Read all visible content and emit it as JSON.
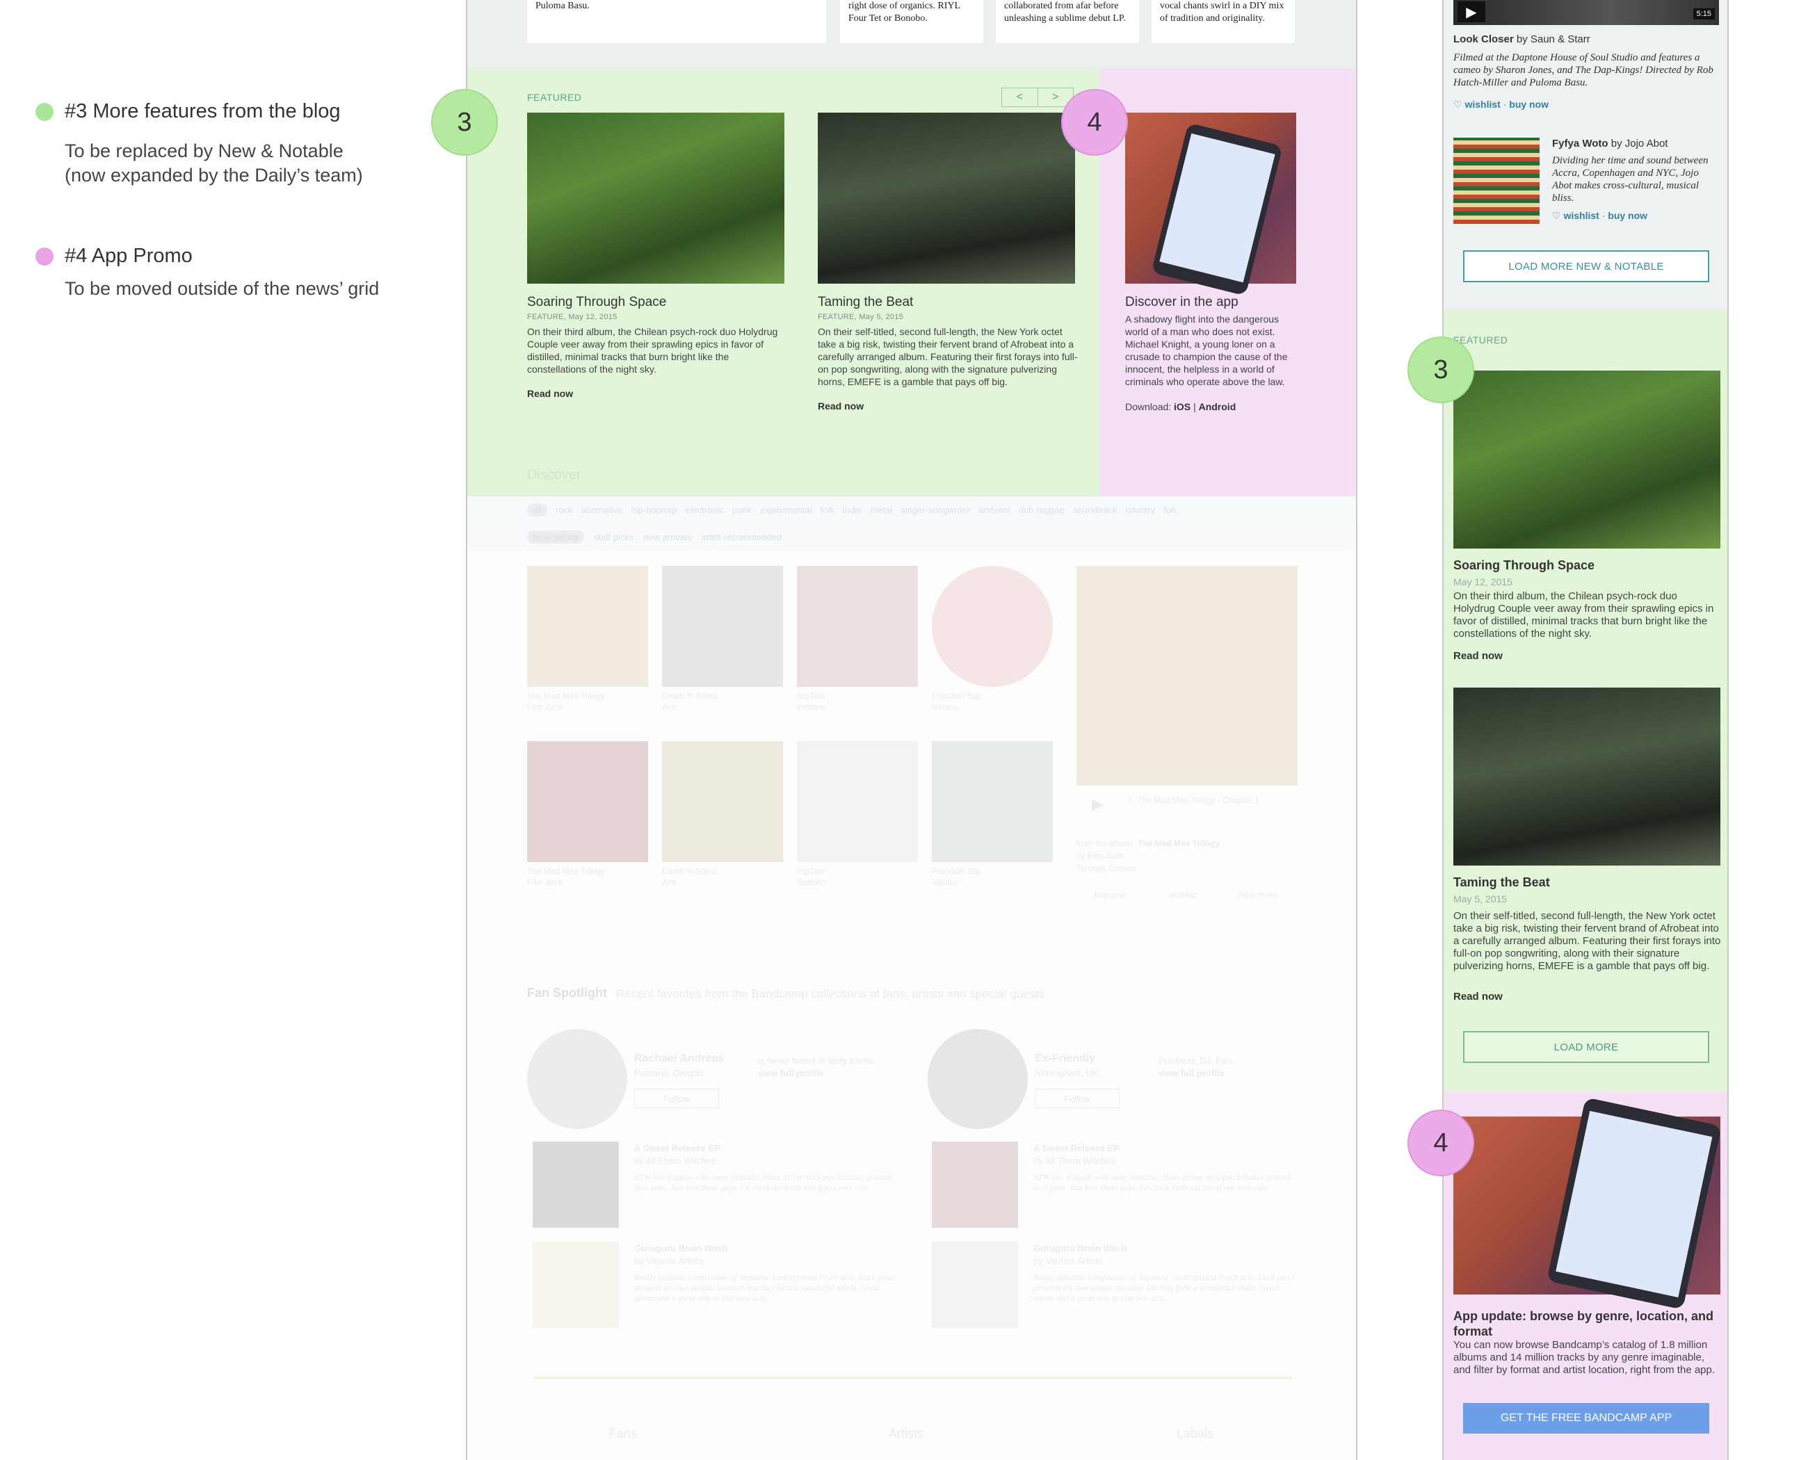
{
  "legend": {
    "items": [
      {
        "title": "#3 More features from the blog",
        "desc": "To be replaced by New & Notable\n(now expanded by the Daily’s team)",
        "color": "#a8e69a"
      },
      {
        "title": "#4 App Promo",
        "desc": "To be moved outside of the news’ grid",
        "color": "#e7a3e6"
      }
    ]
  },
  "badges": {
    "three": "3",
    "four": "4"
  },
  "main": {
    "top_cards": [
      "Puloma Basu.",
      "right dose of organics. RIYL\nFour Tet or Bonobo.",
      "collaborated from afar before\nunleashing a sublime debut LP.",
      "vocal chants swirl in a DIY mix\nof tradition and originality."
    ],
    "featured": {
      "label": "FEATURED",
      "pager": {
        "prev": "<",
        "next": ">"
      },
      "articles": [
        {
          "title": "Soaring Through Space",
          "date": "FEATURE, May 12, 2015",
          "body": "On their third album, the Chilean psych-rock duo Holydrug Couple veer away from their sprawling epics in favor of distilled, minimal tracks that burn bright like the constellations of the night sky.",
          "link": "Read now"
        },
        {
          "title": "Taming the Beat",
          "date": "FEATURE, May 5, 2015",
          "body": "On their self-titled, second full-length, the New York octet take a big risk, twisting their fervent brand of Afrobeat into a carefully arranged album. Featuring their first forays into full-on pop songwriting, along with the signature pulverizing horns, EMEFE is a gamble that pays off big.",
          "link": "Read now"
        }
      ],
      "app": {
        "title": "Discover in the app",
        "body": "A shadowy flight into the dangerous world of a man who does not exist. Michael Knight, a young loner on a crusade to champion the cause of the innocent, the helpless in a world of criminals who operate above the law.",
        "download_label": "Download:",
        "ios": "iOS",
        "sep": "|",
        "android": "Android"
      }
    },
    "faded": {
      "discover": "Discover",
      "chips_genre": [
        "all",
        "rock",
        "alternative",
        "hip-hop/rap",
        "electronic",
        "punk",
        "experimental",
        "folk",
        "indie",
        "metal",
        "singer-songwriter",
        "ambient",
        "dub reggae",
        "soundtrack",
        "country",
        "fun"
      ],
      "chips_sort": [
        "best-selling",
        "staff picks",
        "new arrivals",
        "artist-recommended"
      ],
      "albums": [
        {
          "title": "The Mad Max Trilogy",
          "artist": "Film Junk"
        },
        {
          "title": "Death In Silent",
          "artist": "Ane"
        },
        {
          "title": "RipTide",
          "artist": "Delaine"
        },
        {
          "title": "Freudian Slip",
          "artist": "Villains"
        },
        {
          "title": "The Mad Max Trilogy",
          "artist": "Film Junk"
        },
        {
          "title": "Death In Silent",
          "artist": "Ane"
        },
        {
          "title": "RipTide",
          "artist": "Delaine"
        },
        {
          "title": "Freudian Slip",
          "artist": "Villains"
        }
      ],
      "player": {
        "track": "1. The Mad Max Trilogy - Chapter 1",
        "from_label": "from the album",
        "album": "The Mad Max Trilogy",
        "by": "by Film Junk",
        "location": "Toronto, Ontario",
        "buy": "buy now",
        "wishlist": "wishlist",
        "hear_more": "hear more"
      },
      "fan_spotlight": {
        "title": "Fan Spotlight",
        "subtitle": "Recent favorites from the Bandcamp collections of fans, artists and special guests",
        "fans": [
          {
            "name": "Rachael Andreas",
            "location": "Portland, Oregon",
            "quote": "is never bored of tasty tracks.",
            "profile": "view full profile",
            "follow": "Follow"
          },
          {
            "name": "Ex-Friendly",
            "location": "Nottingham, UK",
            "quote": "Producer, DJ, Fan.",
            "profile": "view full profile",
            "follow": "Follow"
          }
        ],
        "releases": [
          {
            "title": "A Sweet Release EP",
            "by": "by All Them Witches",
            "text": "ATW hits it again with some fantastic, blues driven rock/psych/house-ground-to-it jams. Just love these guys. I'd check them out live if you ever can."
          },
          {
            "title": "Guruguru Brain Wash",
            "by": "by Various Artists",
            "text": "Really fantastic compilation of Japanese Underground Psych acts. Each piece presents it's own unique location, but they form a wonderful whole. Great album and a great way to find new acts."
          }
        ]
      },
      "bottom_tabs": [
        "Fans",
        "Artists",
        "Labels"
      ]
    }
  },
  "right": {
    "top": {
      "duration": "5:15",
      "item1": {
        "title": "Look Closer",
        "by": "by Saun & Starr",
        "desc": "Filmed at the Daptone House of Soul Studio and features a cameo by Sharon Jones, and The Dap-Kings! Directed by Rob Hatch-Miller and Puloma Basu."
      },
      "item2": {
        "title": "Fyfya Woto",
        "by": "by Jojo Abot",
        "desc": "Dividing her time and sound between Accra, Copenhagen and NYC, Jojo Abot makes cross-cultural, musical bliss."
      },
      "wishlist": "wishlist",
      "dot": "·",
      "buy_now": "buy now",
      "load_more": "LOAD MORE NEW & NOTABLE"
    },
    "featured": {
      "label": "FEATURED",
      "articles": [
        {
          "title": "Soaring Through Space",
          "date": "May 12, 2015",
          "body": "On their third album, the Chilean psych-rock duo Holydrug Couple veer away from their sprawling epics in favor of distilled, minimal tracks that burn bright like the constellations of the night sky.",
          "link": "Read now"
        },
        {
          "title": "Taming the Beat",
          "date": "May 5, 2015",
          "body": "On their self-titled, second full-length, the New York octet take a big risk, twisting their fervent brand of Afrobeat into a carefully arranged album. Featuring their first forays into full-on pop songwriting, along with their signature pulverizing horns, EMEFE is a gamble that pays off big.",
          "link": "Read now"
        }
      ],
      "load_more": "LOAD MORE"
    },
    "app": {
      "title": "App update: browse by genre, location, and format",
      "body": "You can now browse Bandcamp’s catalog of 1.8 million albums and 14 million tracks by any genre imaginable, and filter by format and artist location, right from the app.",
      "button": "GET THE FREE BANDCAMP APP"
    }
  },
  "colors": {
    "green_zone": "#e3f5d9",
    "pink_zone": "#f5e0f5",
    "badge_green": "#b4eaa0",
    "badge_pink": "#ecaaea",
    "app_button": "#6d9fe8"
  }
}
